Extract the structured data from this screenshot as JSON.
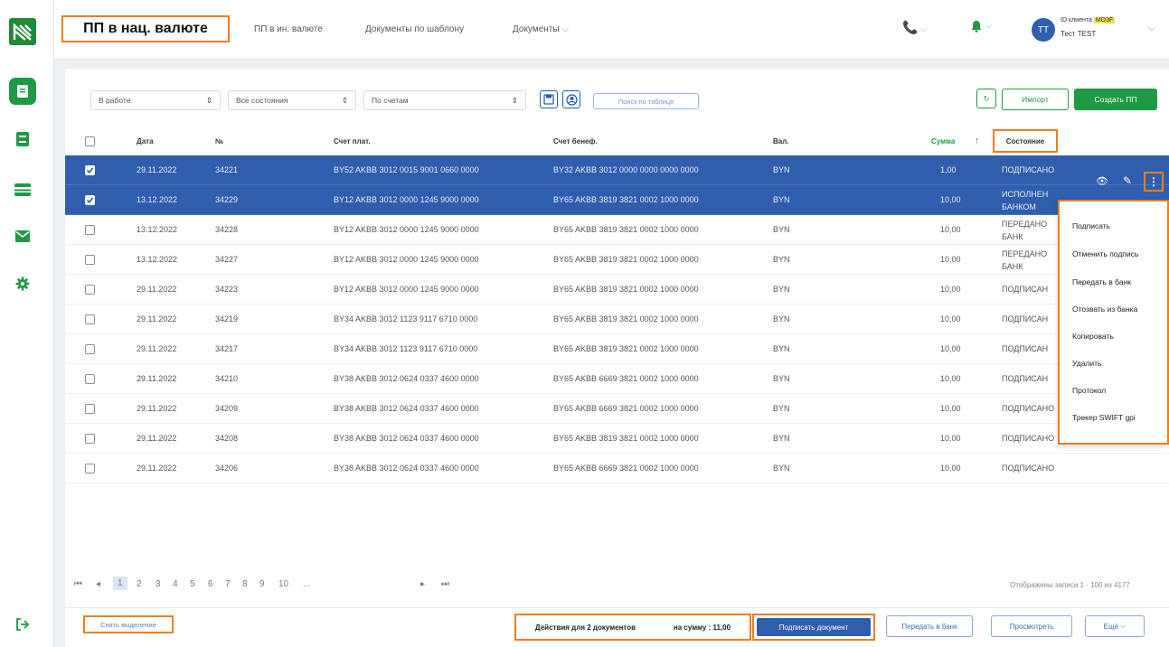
{
  "sidebar": {
    "icons": [
      "document-icon",
      "book-icon",
      "card-icon",
      "mail-icon",
      "gear-icon",
      "logout-icon"
    ]
  },
  "header": {
    "title": "ПП в нац. валюте",
    "nav": [
      "ПП в ин. валюте",
      "Документы по шаблону",
      "Документы"
    ],
    "client_id_label": "ID клиента",
    "client_id_value": "MO3F",
    "user_name": "Тест TEST",
    "avatar_initials": "ТТ"
  },
  "filters": {
    "status": "В работе",
    "states": "Все состояния",
    "accounts": "По счетам",
    "search_placeholder": "Поиск по таблице"
  },
  "actions": {
    "import": "Импорт",
    "create": "Создать ПП"
  },
  "table": {
    "headers": {
      "date": "Дата",
      "num": "№",
      "payer": "Счет плат.",
      "benef": "Счет бенеф.",
      "cur": "Вал.",
      "sum": "Сумма",
      "sort": "↑",
      "state": "Состояние"
    },
    "rows": [
      {
        "date": "29.11.2022",
        "num": "34221",
        "payer": "BY52 AKBB 3012 0015 9001 0660 0000",
        "benef": "BY32 AKBB 3012 0000 0000 0000 0000",
        "cur": "BYN",
        "sum": "1,00",
        "state": "ПОДПИСАНО",
        "state2": "",
        "selected": true
      },
      {
        "date": "13.12.2022",
        "num": "34229",
        "payer": "BY12 AKBB 3012 0000 1245 9000 0000",
        "benef": "BY65 AKBB 3819 3821 0002 1000 0000",
        "cur": "BYN",
        "sum": "10,00",
        "state": "ИСПОЛНЕН",
        "state2": "БАНКОМ",
        "selected": true
      },
      {
        "date": "13.12.2022",
        "num": "34228",
        "payer": "BY12 AKBB 3012 0000 1245 9000 0000",
        "benef": "BY65 AKBB 3819 3821 0002 1000 0000",
        "cur": "BYN",
        "sum": "10,00",
        "state": "ПЕРЕДАНО",
        "state2": "БАНК",
        "selected": false
      },
      {
        "date": "13.12.2022",
        "num": "34227",
        "payer": "BY12 AKBB 3012 0000 1245 9000 0000",
        "benef": "BY65 AKBB 3819 3821 0002 1000 0000",
        "cur": "BYN",
        "sum": "10,00",
        "state": "ПЕРЕДАНО",
        "state2": "БАНК",
        "selected": false
      },
      {
        "date": "29.11.2022",
        "num": "34223",
        "payer": "BY12 AKBB 3012 0000 1245 9000 0000",
        "benef": "BY65 AKBB 3819 3821 0002 1000 0000",
        "cur": "BYN",
        "sum": "10,00",
        "state": "ПОДПИСАН",
        "state2": "",
        "selected": false
      },
      {
        "date": "29.11.2022",
        "num": "34219",
        "payer": "BY34 AKBB 3012 1123 9117 6710 0000",
        "benef": "BY65 AKBB 3819 3821 0002 1000 0000",
        "cur": "BYN",
        "sum": "10,00",
        "state": "ПОДПИСАН",
        "state2": "",
        "selected": false
      },
      {
        "date": "29.11.2022",
        "num": "34217",
        "payer": "BY34 AKBB 3012 1123 9117 6710 0000",
        "benef": "BY65 AKBB 3819 3821 0002 1000 0000",
        "cur": "BYN",
        "sum": "10,00",
        "state": "ПОДПИСАН",
        "state2": "",
        "selected": false
      },
      {
        "date": "29.11.2022",
        "num": "34210",
        "payer": "BY38 AKBB 3012 0624 0337 4600 0000",
        "benef": "BY65 AKBB 6669 3821 0002 1000 0000",
        "cur": "BYN",
        "sum": "10,00",
        "state": "ПОДПИСАН",
        "state2": "",
        "selected": false
      },
      {
        "date": "29.11.2022",
        "num": "34209",
        "payer": "BY38 AKBB 3012 0624 0337 4600 0000",
        "benef": "BY65 AKBB 6669 3821 0002 1000 0000",
        "cur": "BYN",
        "sum": "10,00",
        "state": "ПОДПИСАНО",
        "state2": "",
        "selected": false
      },
      {
        "date": "29.11.2022",
        "num": "34208",
        "payer": "BY38 AKBB 3012 0624 0337 4600 0000",
        "benef": "BY65 AKBB 3819 3821 0002 1000 0000",
        "cur": "BYN",
        "sum": "10,00",
        "state": "ПОДПИСАНО",
        "state2": "",
        "selected": false
      },
      {
        "date": "29.11.2022",
        "num": "34206",
        "payer": "BY38 AKBB 3012 0624 0337 4600 0000",
        "benef": "BY65 AKBB 6669 3821 0002 1000 0000",
        "cur": "BYN",
        "sum": "10,00",
        "state": "ПОДПИСАНО",
        "state2": "",
        "selected": false
      }
    ]
  },
  "context_menu": [
    "Подписать",
    "Отменить подпись",
    "Передать в банк",
    "Отозвать из банка",
    "Копировать",
    "Удалить",
    "Протокол",
    "Трекер SWIFT gpi"
  ],
  "pagination": {
    "pages": [
      "1",
      "2",
      "3",
      "4",
      "5",
      "6",
      "7",
      "8",
      "9",
      "10",
      "..."
    ],
    "current": "1",
    "records": "Отображены записи 1 - 100 из 4177"
  },
  "footer": {
    "clear_selection": "Снять выделение",
    "actions_for": "Действия для 2 документов",
    "sum_label": "на сумму : 11,00",
    "sign": "Подписать документ",
    "send": "Передать в банк",
    "view": "Просмотреть",
    "more": "Ещё"
  },
  "colors": {
    "accent_green": "#1e9a44",
    "selected_row": "#2f5eae",
    "highlight": "#f07d1e"
  }
}
